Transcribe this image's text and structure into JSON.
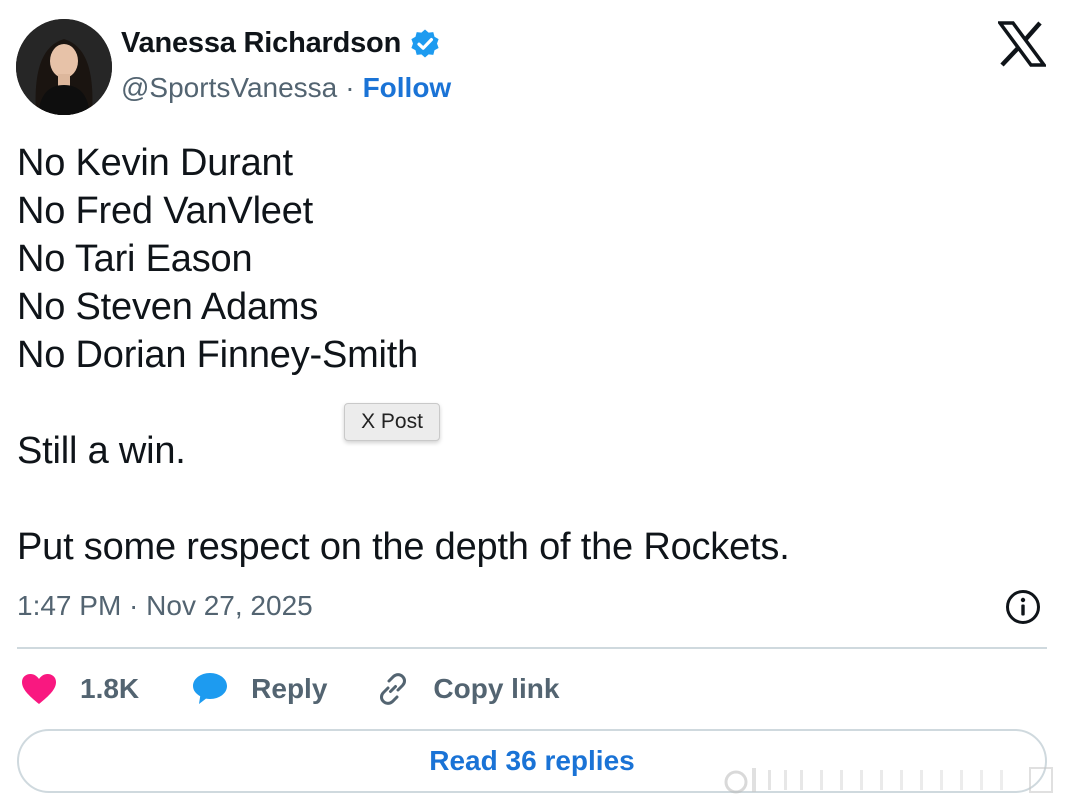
{
  "author": {
    "name": "Vanessa Richardson",
    "handle": "@SportsVanessa",
    "separator": "·",
    "follow_label": "Follow"
  },
  "tweet": {
    "lines": [
      "No Kevin Durant",
      "No Fred VanVleet",
      "No Tari Eason",
      "No Steven Adams",
      "No Dorian Finney-Smith",
      "",
      "Still a win.",
      "",
      "Put some respect on the depth of the Rockets."
    ],
    "timestamp": "1:47 PM · Nov 27, 2025"
  },
  "tooltip": "X Post",
  "actions": {
    "like_count": "1.8K",
    "reply_label": "Reply",
    "copy_label": "Copy link"
  },
  "read_replies_label": "Read 36 replies",
  "colors": {
    "accent": "#1a73d6",
    "verified": "#1d9bf0",
    "like": "#f91880",
    "secondary_text": "#536471",
    "divider": "#cfd9de"
  },
  "icons": [
    "verified-badge-icon",
    "x-logo-icon",
    "info-icon",
    "heart-icon",
    "reply-bubble-icon",
    "link-icon"
  ]
}
